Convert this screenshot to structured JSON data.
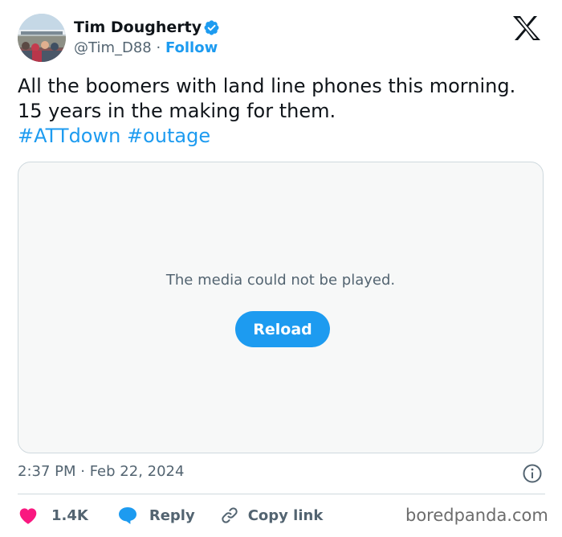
{
  "author": {
    "name": "Tim Dougherty",
    "handle": "@Tim_D88",
    "separator": "·",
    "follow_label": "Follow"
  },
  "tweet": {
    "text": "All the boomers with land line phones this morning. 15 years in the making for them.",
    "hashtags": [
      "#ATTdown",
      "#outage"
    ]
  },
  "media": {
    "message": "The media could not be played.",
    "reload_label": "Reload"
  },
  "timestamp": "2:37 PM · Feb 22, 2024",
  "actions": {
    "like_count": "1.4K",
    "reply_label": "Reply",
    "copy_link_label": "Copy link"
  },
  "watermark": "boredpanda.com",
  "colors": {
    "accent": "#1d9bf0",
    "like": "#f91880",
    "text": "#0f1419",
    "muted": "#536471",
    "border": "#cfd9de"
  },
  "icons": [
    "verified-badge-icon",
    "x-logo-icon",
    "info-icon",
    "heart-icon",
    "reply-bubble-icon",
    "link-icon"
  ]
}
